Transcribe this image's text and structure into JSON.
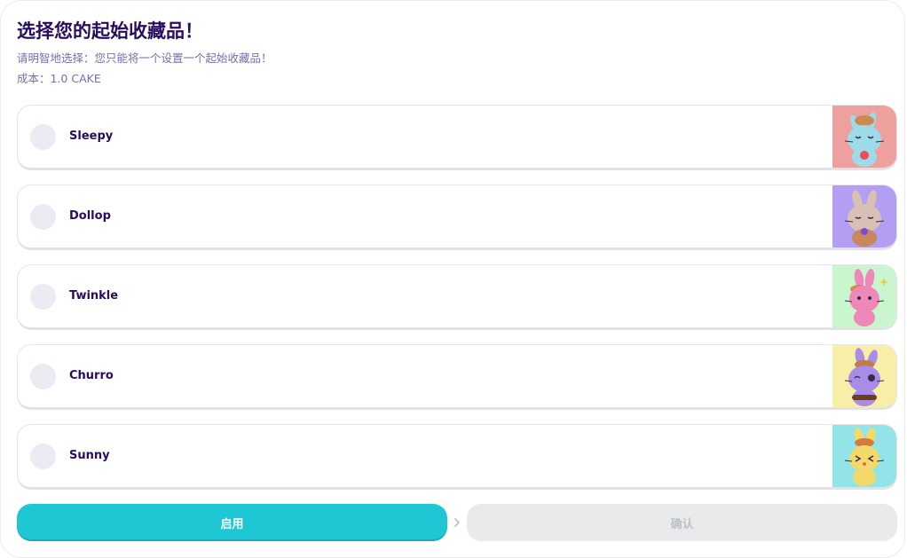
{
  "header": {
    "title": "选择您的起始收藏品！",
    "subtitle": "请明智地选择：您只能将一个设置一个起始收藏品！",
    "cost": "成本：1.0 CAKE"
  },
  "options": [
    {
      "label": "Sleepy",
      "image": "sleepy-bunny-image",
      "bg_color": "#eea09e",
      "body_color": "#9ddbe8"
    },
    {
      "label": "Dollop",
      "image": "dollop-bunny-image",
      "bg_color": "#b39ef4",
      "body_color": "#d9c0b4"
    },
    {
      "label": "Twinkle",
      "image": "twinkle-bunny-image",
      "bg_color": "#c9f5cf",
      "body_color": "#ee88b8"
    },
    {
      "label": "Churro",
      "image": "churro-bunny-image",
      "bg_color": "#f7efa8",
      "body_color": "#a98be8"
    },
    {
      "label": "Sunny",
      "image": "sunny-bunny-image",
      "bg_color": "#93e4e8",
      "body_color": "#f2d96a"
    }
  ],
  "actions": {
    "enable_label": "启用",
    "confirm_label": "确认",
    "arrow_icon": "chevron-right-icon"
  },
  "colors": {
    "primary": "#1fc7d4",
    "text_dark": "#280d5f",
    "text_muted": "#7a6eaa",
    "disabled_bg": "#e9eaeb",
    "disabled_text": "#bdc2c4",
    "radio_bg": "#eeeaf4"
  }
}
